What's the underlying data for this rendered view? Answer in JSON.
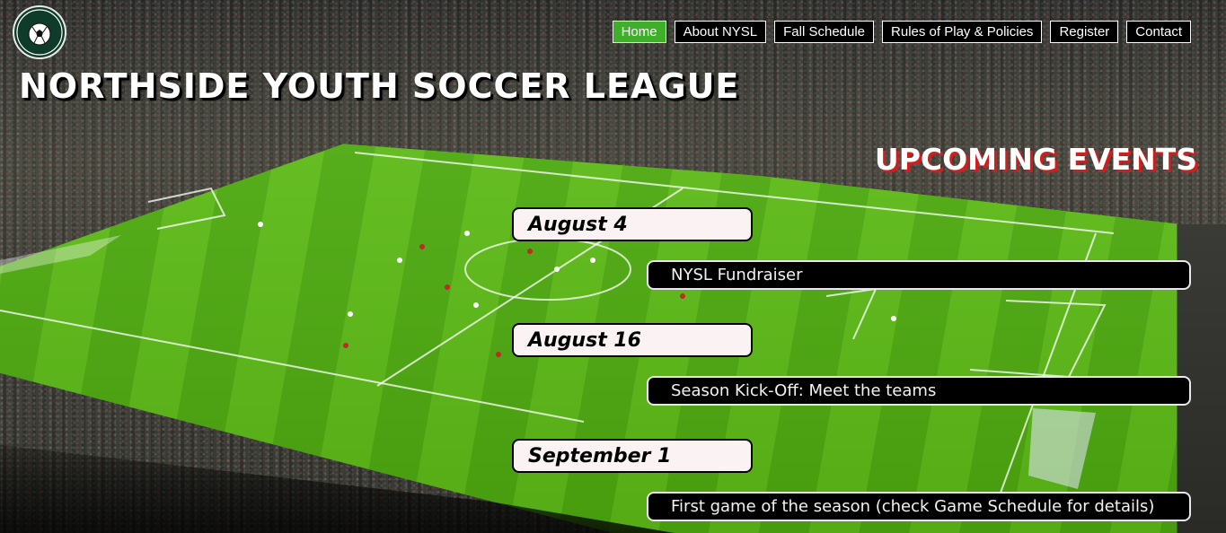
{
  "brand": {
    "logo_icon": "soccer-ball-icon",
    "logo_text_top": "NORTHSIDE YOUTH",
    "logo_text_bottom": "SOCCER LEAGUE",
    "title": "NORTHSIDE YOUTH SOCCER LEAGUE"
  },
  "nav": {
    "items": [
      {
        "label": "Home",
        "active": true
      },
      {
        "label": "About NYSL",
        "active": false
      },
      {
        "label": "Fall Schedule",
        "active": false
      },
      {
        "label": "Rules of Play & Policies",
        "active": false
      },
      {
        "label": "Register",
        "active": false
      },
      {
        "label": "Contact",
        "active": false
      }
    ],
    "active_color": "#3fae2a"
  },
  "events": {
    "heading": "UPCOMING EVENTS",
    "heading_shadow_color": "#d31d1d",
    "list": [
      {
        "date": "August 4",
        "description": "NYSL Fundraiser"
      },
      {
        "date": "August 16",
        "description": "Season Kick-Off: Meet the teams"
      },
      {
        "date": "September 1",
        "description": "First game of the season (check Game Schedule for details)"
      }
    ]
  }
}
